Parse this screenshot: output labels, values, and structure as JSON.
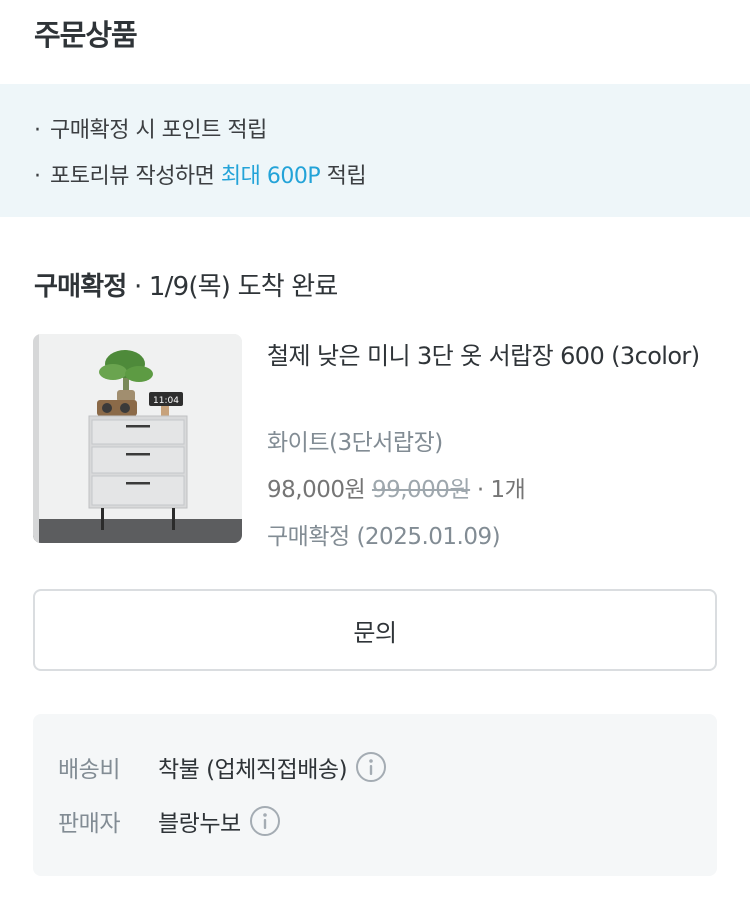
{
  "header": {
    "title": "주문상품"
  },
  "notice": {
    "bullet": "·",
    "line1": "구매확정 시 포인트 적립",
    "line2_prefix": "포토리뷰 작성하면 ",
    "line2_highlight": "최대 600P",
    "line2_suffix": " 적립"
  },
  "order": {
    "status_label": "구매확정",
    "status_detail": " · 1/9(목) 도착 완료"
  },
  "product": {
    "name": "철제 낮은 미니 3단 옷 서랍장 600 (3color)",
    "option": "화이트(3단서랍장)",
    "price": "98,000원",
    "original_price": "99,000원",
    "quantity": " · 1개",
    "status": "구매확정 (2025.01.09)",
    "image_clock_text": "11:04"
  },
  "actions": {
    "inquiry_label": "문의"
  },
  "shipping": {
    "fee_label": "배송비",
    "fee_value": "착불 (업체직접배송)",
    "seller_label": "판매자",
    "seller_value": "블랑누보"
  },
  "colors": {
    "accent": "#23a3d8",
    "notice_bg": "#eef6f9",
    "info_bg": "#f5f7f8"
  },
  "icons": {
    "info": "info-circle-icon"
  }
}
